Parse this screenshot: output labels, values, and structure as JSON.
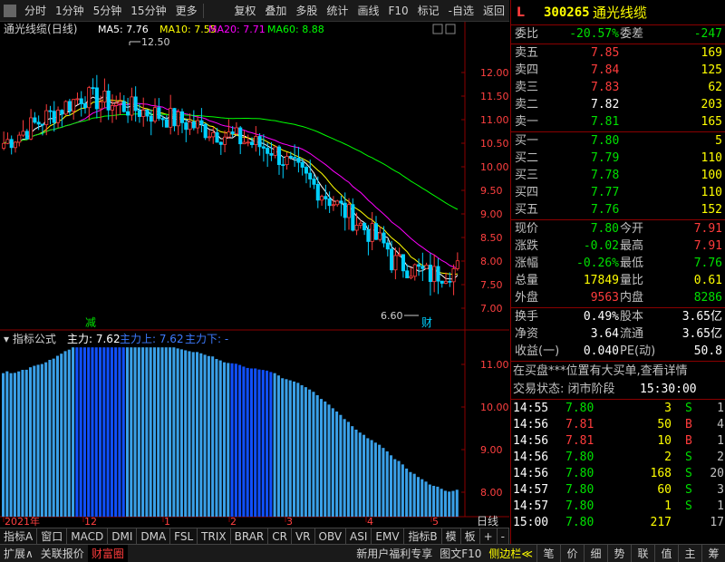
{
  "toolbar": {
    "left_items": [
      "分时",
      "1分钟",
      "5分钟",
      "15分钟",
      "更多"
    ],
    "right_items": [
      "复权",
      "叠加",
      "多股",
      "统计",
      "画线",
      "F10",
      "标记",
      "-自选",
      "返回"
    ]
  },
  "stock": {
    "name": "通光线缆",
    "code": "300265",
    "prefix": "L",
    "period": "(日线)"
  },
  "ma_legend": {
    "ma5": "MA5: 7.76",
    "ma10": "MA10: 7.55",
    "ma20": "MA20: 7.71",
    "ma60": "MA60: 8.88",
    "ma5_color": "#ffffff",
    "ma10_color": "#ffff00",
    "ma20_color": "#ff00ff",
    "ma60_color": "#00ff00"
  },
  "annotations": {
    "high_label": "12.50",
    "low_label": "6.60",
    "mark_jian": "减",
    "mark_cai": "财"
  },
  "indicator": {
    "title": "指标公式",
    "main_label": "主力: 7.62",
    "main_up": "主力上: 7.62",
    "main_down": "主力下: -"
  },
  "price_axis": [
    "12.00",
    "11.50",
    "11.00",
    "10.50",
    "10.00",
    "9.50",
    "9.00",
    "8.50",
    "8.00",
    "7.50",
    "7.00"
  ],
  "ind_axis": [
    "11.00",
    "10.00",
    "9.00",
    "8.00"
  ],
  "date_axis": [
    "2021年",
    "12",
    "1",
    "2",
    "3",
    "4",
    "5"
  ],
  "period_label": "日线",
  "quote": {
    "webi_label": "委比",
    "webi_value": "-20.57%",
    "weicha_label": "委差",
    "weicha_value": "-247",
    "asks": [
      {
        "label": "卖五",
        "price": "7.85",
        "vol": "169"
      },
      {
        "label": "卖四",
        "price": "7.84",
        "vol": "125"
      },
      {
        "label": "卖三",
        "price": "7.83",
        "vol": "62"
      },
      {
        "label": "卖二",
        "price": "7.82",
        "vol": "203"
      },
      {
        "label": "卖一",
        "price": "7.81",
        "vol": "165"
      }
    ],
    "bids": [
      {
        "label": "买一",
        "price": "7.80",
        "vol": "5"
      },
      {
        "label": "买二",
        "price": "7.79",
        "vol": "110"
      },
      {
        "label": "买三",
        "price": "7.78",
        "vol": "100"
      },
      {
        "label": "买四",
        "price": "7.77",
        "vol": "110"
      },
      {
        "label": "买五",
        "price": "7.76",
        "vol": "152"
      }
    ],
    "stats": [
      {
        "l1": "现价",
        "v1": "7.80",
        "l2": "今开",
        "v2": "7.91"
      },
      {
        "l1": "涨跌",
        "v1": "-0.02",
        "l2": "最高",
        "v2": "7.91"
      },
      {
        "l1": "涨幅",
        "v1": "-0.26%",
        "l2": "最低",
        "v2": "7.76"
      },
      {
        "l1": "总量",
        "v1": "17849",
        "l2": "量比",
        "v2": "0.61"
      },
      {
        "l1": "外盘",
        "v1": "9563",
        "l2": "内盘",
        "v2": "8286"
      }
    ],
    "stats2": [
      {
        "l1": "换手",
        "v1": "0.49%",
        "l2": "股本",
        "v2": "3.65亿"
      },
      {
        "l1": "净资",
        "v1": "3.64",
        "l2": "流通",
        "v2": "3.65亿"
      },
      {
        "l1": "收益(一)",
        "v1": "0.040",
        "l2": "PE(动)",
        "v2": "50.8"
      }
    ],
    "notice": "在买盘***位置有大买单,查看详情",
    "status_label": "交易状态: 闭市阶段",
    "status_time": "15:30:00"
  },
  "ticks": [
    {
      "time": "14:55",
      "price": "7.80",
      "vol": "3",
      "side": "S",
      "n": "1"
    },
    {
      "time": "14:56",
      "price": "7.81",
      "vol": "50",
      "side": "B",
      "n": "4"
    },
    {
      "time": "14:56",
      "price": "7.81",
      "vol": "10",
      "side": "B",
      "n": "1"
    },
    {
      "time": "14:56",
      "price": "7.80",
      "vol": "2",
      "side": "S",
      "n": "2"
    },
    {
      "time": "14:56",
      "price": "7.80",
      "vol": "168",
      "side": "S",
      "n": "20"
    },
    {
      "time": "14:57",
      "price": "7.80",
      "vol": "60",
      "side": "S",
      "n": "3"
    },
    {
      "time": "14:57",
      "price": "7.80",
      "vol": "1",
      "side": "S",
      "n": "1"
    },
    {
      "time": "15:00",
      "price": "7.80",
      "vol": "217",
      "side": "",
      "n": "17"
    }
  ],
  "tabs_row1": [
    "指标A",
    "窗口",
    "MACD",
    "DMI",
    "DMA",
    "FSL",
    "TRIX",
    "BRAR",
    "CR",
    "VR",
    "OBV",
    "ASI",
    "EMV"
  ],
  "tabs_row1_right": [
    "指标B",
    "模",
    "板",
    "+",
    "-"
  ],
  "tabs_row2": [
    "扩展∧",
    "关联报价",
    "财富圈"
  ],
  "tabs_row2_right": [
    "新用户福利专享",
    "图文F10",
    "侧边栏≪"
  ],
  "tabs_row3": [
    "笔",
    "价",
    "细",
    "势",
    "联",
    "值",
    "主",
    "筹"
  ]
}
